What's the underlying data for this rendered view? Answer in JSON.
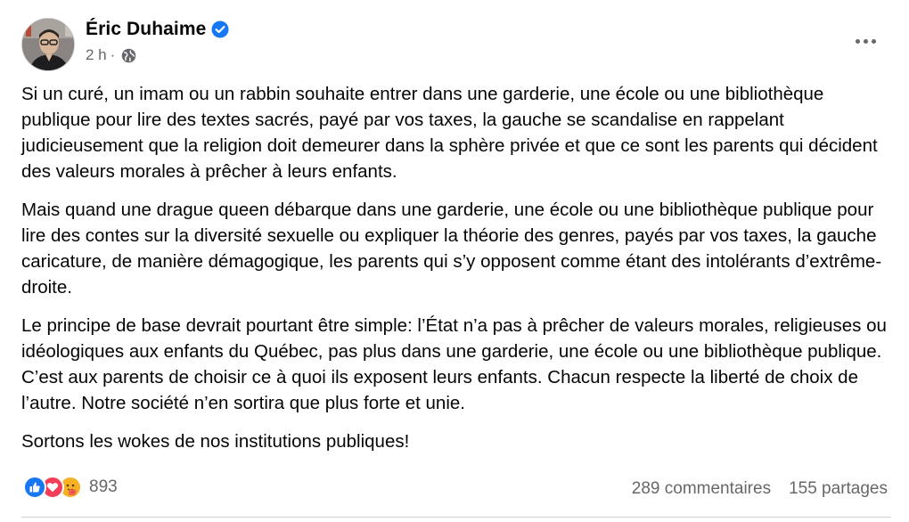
{
  "post": {
    "author": "Éric Duhaime",
    "verified_icon": "verified-badge-icon",
    "timestamp": "2 h",
    "separator": "·",
    "audience_icon": "globe-icon",
    "more_icon": "more-options-icon",
    "paragraphs": [
      "Si un curé, un imam ou un rabbin souhaite entrer dans une garderie, une école ou une bibliothèque publique pour lire des textes sacrés, payé par vos taxes, la gauche se scandalise en rappelant judicieusement que la religion doit demeurer dans la sphère privée et que ce sont les parents qui décident des valeurs morales à prêcher à leurs enfants.",
      "Mais quand une drague queen débarque dans une garderie, une école ou une bibliothèque publique pour lire des contes sur la diversité sexuelle ou expliquer la théorie des genres, payés par vos taxes, la gauche caricature, de manière démagogique, les parents qui s’y opposent comme étant des intolérants d’extrême-droite.",
      "Le principe de base devrait pourtant être simple: l’État n’a pas à prêcher de valeurs morales, religieuses ou idéologiques aux enfants du Québec, pas plus dans une garderie, une école ou une bibliothèque publique. C’est aux parents de choisir ce à quoi ils exposent leurs enfants. Chacun respecte la liberté de choix de l’autre. Notre société n’en sortira que plus forte et unie.",
      "Sortons les wokes de nos institutions publiques!"
    ],
    "reactions": {
      "icons": [
        "like-reaction-icon",
        "love-reaction-icon",
        "care-reaction-icon"
      ],
      "count": "893"
    },
    "comments": "289 commentaires",
    "shares": "155 partages"
  },
  "colors": {
    "text": "#050505",
    "secondary": "#65676b",
    "brand_blue": "#1877f2",
    "love_red": "#f33e58",
    "care_yellow": "#f7b125"
  }
}
